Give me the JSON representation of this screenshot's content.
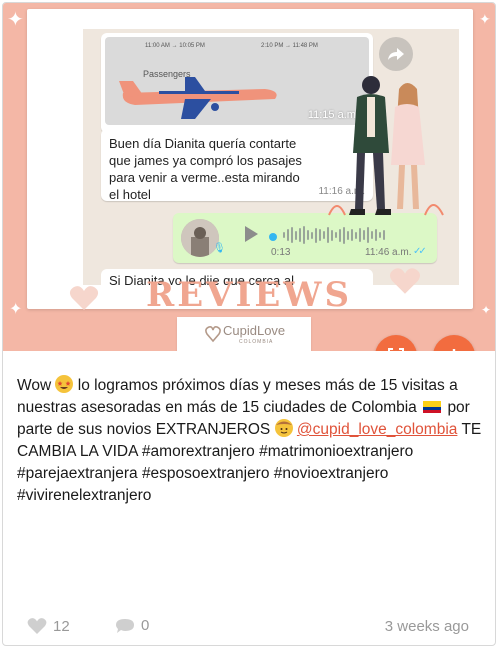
{
  "post": {
    "chat": {
      "image_bubble": {
        "ticket_time_left": "11:00 AM → 10:05 PM",
        "ticket_time_right": "2:10 PM → 11:48 PM",
        "passengers_label": "Passengers",
        "time": "11:15 a.m."
      },
      "message_1": {
        "lines": [
          "Buen día Dianita quería contarte",
          "que james ya compró los pasajes",
          "para venir a verme..esta mirando",
          "el hotel"
        ],
        "time": "11:16 a.m."
      },
      "voice_note": {
        "duration": "0:13",
        "time": "11:46 a.m."
      },
      "message_2_partial": "Si Dianita yo le dije que cerca al"
    },
    "overlay_title": "REVIEWS",
    "logo": {
      "name": "CupidLove",
      "sub": "COLOMBIA"
    },
    "buttons": {
      "expand_icon": "expand-icon",
      "download_icon": "download-icon"
    },
    "caption": {
      "part1": "Wow",
      "part2": "lo logramos próximos días y meses más de 15 visitas a nuestras asesoradas en más de 15 ciudades de Colombia",
      "part3": "por parte de sus novios EXTRANJEROS",
      "mention": "@cupid_love_colombia",
      "part4": "TE CAMBIA LA VIDA #amorextranjero #matrimonioextranjero #parejaextranjera #esposoextranjero #novioextranjero #vivirenelextranjero"
    },
    "stats": {
      "likes": "12",
      "comments": "0",
      "posted": "3 weeks ago"
    },
    "colors": {
      "accent": "#f26c3f",
      "mention": "#e0533a",
      "background_pink": "#f4b7a6"
    }
  }
}
